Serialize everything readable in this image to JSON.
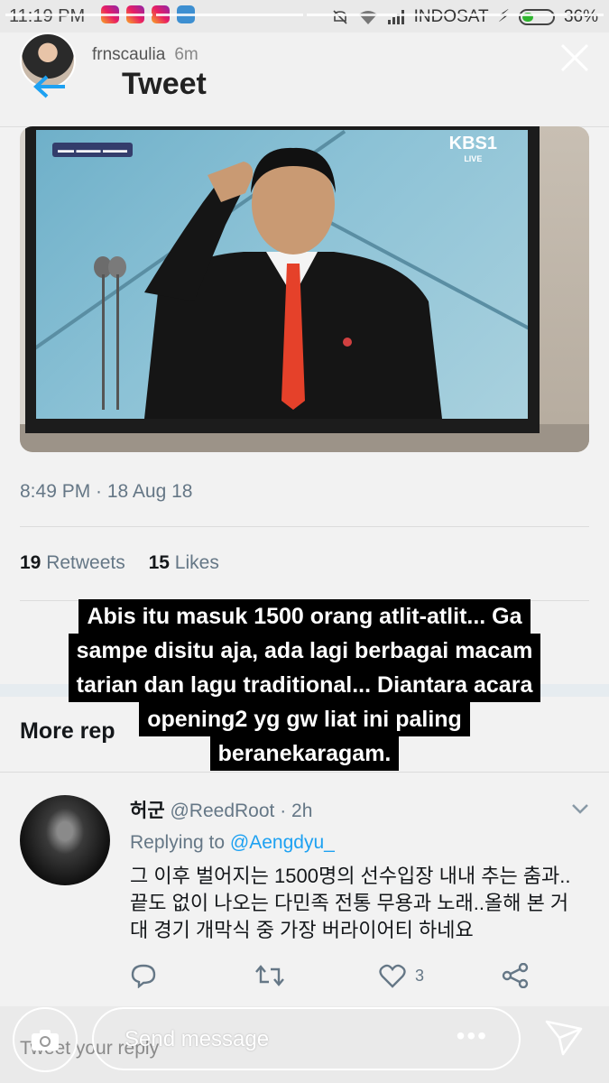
{
  "status_bar": {
    "time": "11:19 PM",
    "carrier": "INDOSAT",
    "battery": "36%",
    "battery_level": 0.36
  },
  "story": {
    "username": "frnscaulia",
    "age": "6m"
  },
  "header": {
    "title": "Tweet"
  },
  "media": {
    "channel": "KBS1",
    "channel_sub": "LIVE"
  },
  "tweet": {
    "timestamp": "8:49 PM · 18 Aug 18",
    "retweets_count": "19",
    "retweets_label": "Retweets",
    "likes_count": "15",
    "likes_label": "Likes"
  },
  "more_replies_label": "More rep",
  "overlay_text": [
    "Abis itu masuk 1500 orang atlit-atlit... Ga",
    "sampe disitu aja, ada lagi berbagai macam",
    "tarian dan lagu traditional... Diantara acara",
    "opening2 yg gw liat ini paling",
    "beranekaragam."
  ],
  "reply": {
    "name": "허군",
    "handle": "@ReedRoot",
    "time": "· 2h",
    "replying_prefix": "Replying to",
    "replying_handle": "@Aengdyu_",
    "text": "그 이후 벌어지는 1500명의 선수입장 내내 추는 춤과..끝도 없이 나오는 다민족 전통 무용과 노래..올해 본 거대 경기 개막식 중 가장 버라이어티 하네요",
    "like_count": "3"
  },
  "bottom": {
    "tweet_reply_placeholder": "Tweet your reply",
    "send_message_placeholder": "Send message",
    "more_dots": "•••"
  },
  "colors": {
    "twitter_blue": "#1da1f2",
    "gray_text": "#657786"
  }
}
